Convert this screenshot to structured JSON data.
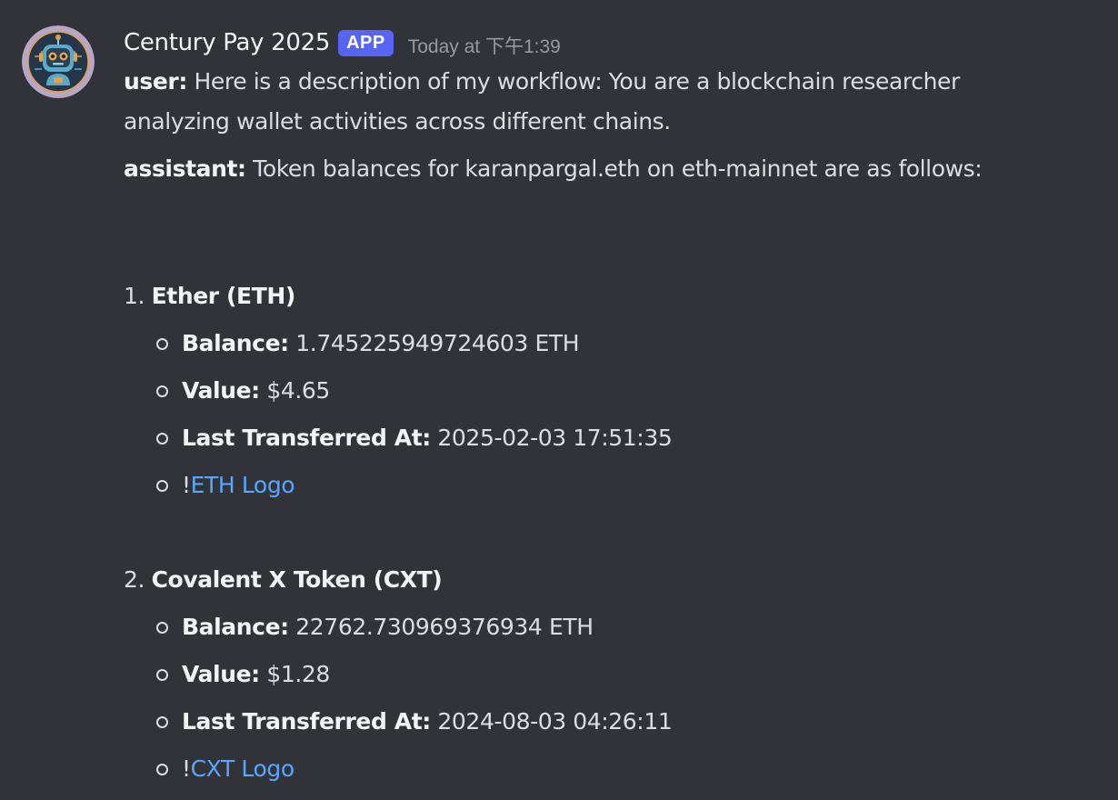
{
  "message": {
    "username": "Century Pay 2025",
    "badge": "APP",
    "timestamp": "Today at 下午1:39",
    "lines": [
      {
        "speaker": "user:",
        "text": " Here is a description of my workflow: You are a blockchain researcher analyzing wallet activities across different chains."
      },
      {
        "speaker": "assistant:",
        "text": " Token balances for karanpargal.eth on eth-mainnet are as follows:"
      }
    ],
    "tokens": [
      {
        "number": "1.",
        "name": "Ether (ETH)",
        "balance_label": "Balance:",
        "balance": " 1.745225949724603 ETH",
        "value_label": "Value:",
        "value": " $4.65",
        "last_label": "Last Transferred At:",
        "last": " 2025-02-03 17:51:35",
        "logo_prefix": "!",
        "logo_link": "ETH Logo"
      },
      {
        "number": "2.",
        "name": "Covalent X Token (CXT)",
        "balance_label": "Balance:",
        "balance": " 22762.730969376934 ETH",
        "value_label": "Value:",
        "value": " $1.28",
        "last_label": "Last Transferred At:",
        "last": " 2024-08-03 04:26:11",
        "logo_prefix": "!",
        "logo_link": "CXT Logo"
      }
    ]
  },
  "colors": {
    "background": "#313338",
    "text": "#dbdee1",
    "username": "#f2f3f5",
    "badge": "#5865f2",
    "timestamp": "#949ba4",
    "link": "#58a6ff"
  },
  "icons": {
    "avatar": "robot-avatar-icon"
  }
}
